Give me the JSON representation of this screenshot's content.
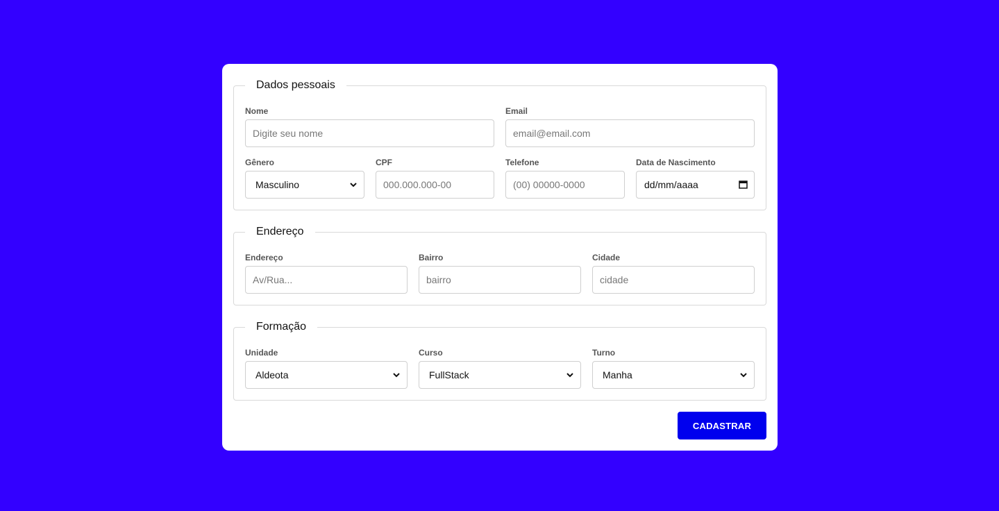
{
  "sections": {
    "personal": {
      "legend": "Dados pessoais",
      "nome": {
        "label": "Nome",
        "placeholder": "Digite seu nome"
      },
      "email": {
        "label": "Email",
        "placeholder": "email@email.com"
      },
      "genero": {
        "label": "Gênero",
        "value": "Masculino"
      },
      "cpf": {
        "label": "CPF",
        "placeholder": "000.000.000-00"
      },
      "telefone": {
        "label": "Telefone",
        "placeholder": "(00) 00000-0000"
      },
      "nascimento": {
        "label": "Data de Nascimento",
        "value": "dd/mm/aaaa"
      }
    },
    "address": {
      "legend": "Endereço",
      "endereco": {
        "label": "Endereço",
        "placeholder": "Av/Rua..."
      },
      "bairro": {
        "label": "Bairro",
        "placeholder": "bairro"
      },
      "cidade": {
        "label": "Cidade",
        "placeholder": "cidade"
      }
    },
    "education": {
      "legend": "Formação",
      "unidade": {
        "label": "Unidade",
        "value": "Aldeota"
      },
      "curso": {
        "label": "Curso",
        "value": "FullStack"
      },
      "turno": {
        "label": "Turno",
        "value": "Manha"
      }
    }
  },
  "submit": {
    "label": "CADASTRAR"
  },
  "colors": {
    "background": "#3300ff",
    "card": "#ffffff",
    "button": "#0000ee"
  }
}
